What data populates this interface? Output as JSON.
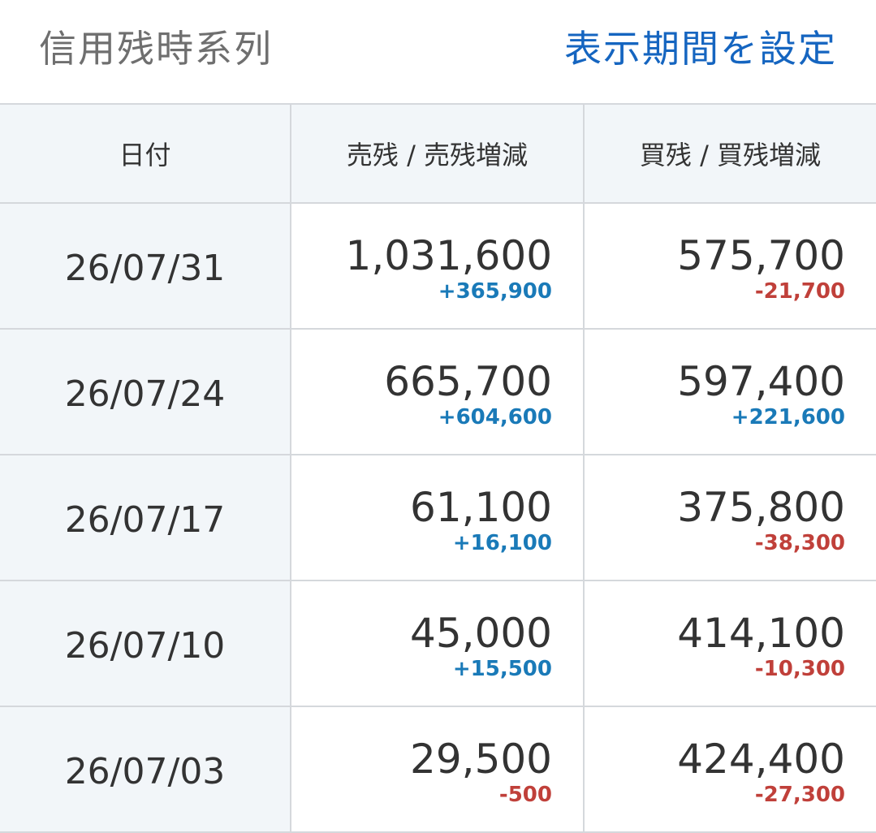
{
  "header": {
    "title": "信用残時系列",
    "period_link": "表示期間を設定"
  },
  "table": {
    "columns": [
      "日付",
      "売残 / 売残増減",
      "買残 / 買残増減"
    ],
    "rows": [
      {
        "date": "26/07/31",
        "sell": "1,031,600",
        "sell_delta": "+365,900",
        "buy": "575,700",
        "buy_delta": "-21,700"
      },
      {
        "date": "26/07/24",
        "sell": "665,700",
        "sell_delta": "+604,600",
        "buy": "597,400",
        "buy_delta": "+221,600"
      },
      {
        "date": "26/07/17",
        "sell": "61,100",
        "sell_delta": "+16,100",
        "buy": "375,800",
        "buy_delta": "-38,300"
      },
      {
        "date": "26/07/10",
        "sell": "45,000",
        "sell_delta": "+15,500",
        "buy": "414,100",
        "buy_delta": "-10,300"
      },
      {
        "date": "26/07/03",
        "sell": "29,500",
        "sell_delta": "-500",
        "buy": "424,400",
        "buy_delta": "-27,300"
      }
    ]
  },
  "colors": {
    "positive": "#1a7ab8",
    "negative": "#c0403a",
    "link": "#1565c0",
    "header_bg": "#f2f6f9"
  }
}
